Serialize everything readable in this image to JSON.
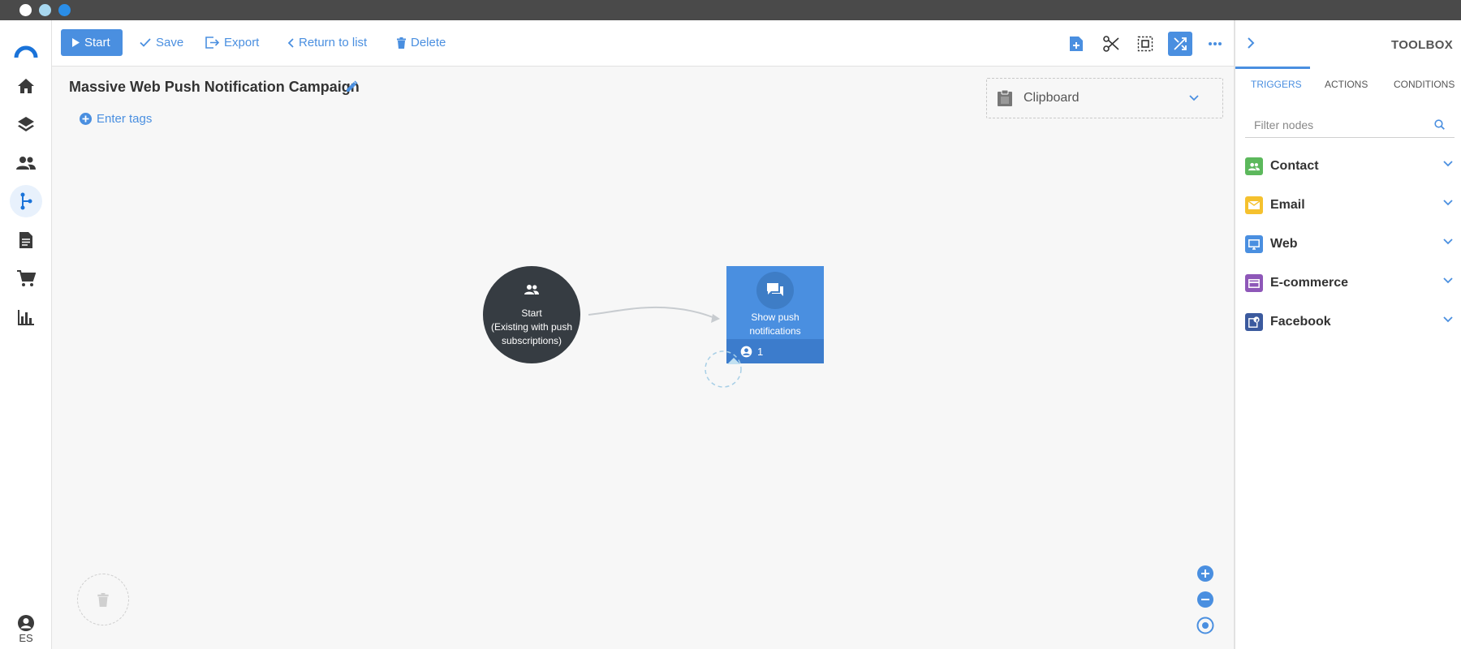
{
  "colors": {
    "accent": "#4a8fe0",
    "start_node": "#363c42",
    "contact": "#5cb85c",
    "email": "#f5c12e",
    "web": "#4a8fe0",
    "ecommerce": "#8e57b8",
    "facebook": "#3b5a9e"
  },
  "left_nav": {
    "items": [
      {
        "name": "home-icon"
      },
      {
        "name": "layers-icon"
      },
      {
        "name": "contacts-icon"
      },
      {
        "name": "campaigns-icon",
        "active": true
      },
      {
        "name": "pages-icon"
      },
      {
        "name": "cart-icon"
      },
      {
        "name": "reports-icon"
      }
    ],
    "language": "ES"
  },
  "toolbar": {
    "start_label": "Start",
    "save_label": "Save",
    "export_label": "Export",
    "return_label": "Return to list",
    "delete_label": "Delete",
    "icons": [
      "add-page-icon",
      "scissors-icon",
      "select-area-icon",
      "auto-arrange-icon",
      "more-icon"
    ]
  },
  "campaign": {
    "title": "Massive Web Push Notification Campaign",
    "tags_label": "Enter tags"
  },
  "clipboard": {
    "label": "Clipboard"
  },
  "nodes": {
    "start": {
      "line1": "Start",
      "line2": "(Existing with push subscriptions)"
    },
    "push": {
      "label": "Show push notifications",
      "count": "1"
    }
  },
  "toolbox": {
    "title": "TOOLBOX",
    "tabs": [
      {
        "label": "TRIGGERS",
        "active": true
      },
      {
        "label": "ACTIONS"
      },
      {
        "label": "CONDITIONS"
      }
    ],
    "filter_placeholder": "Filter nodes",
    "categories": [
      {
        "label": "Contact",
        "icon": "contact-icon"
      },
      {
        "label": "Email",
        "icon": "email-icon"
      },
      {
        "label": "Web",
        "icon": "web-icon"
      },
      {
        "label": "E-commerce",
        "icon": "ecommerce-icon"
      },
      {
        "label": "Facebook",
        "icon": "facebook-icon"
      }
    ]
  }
}
